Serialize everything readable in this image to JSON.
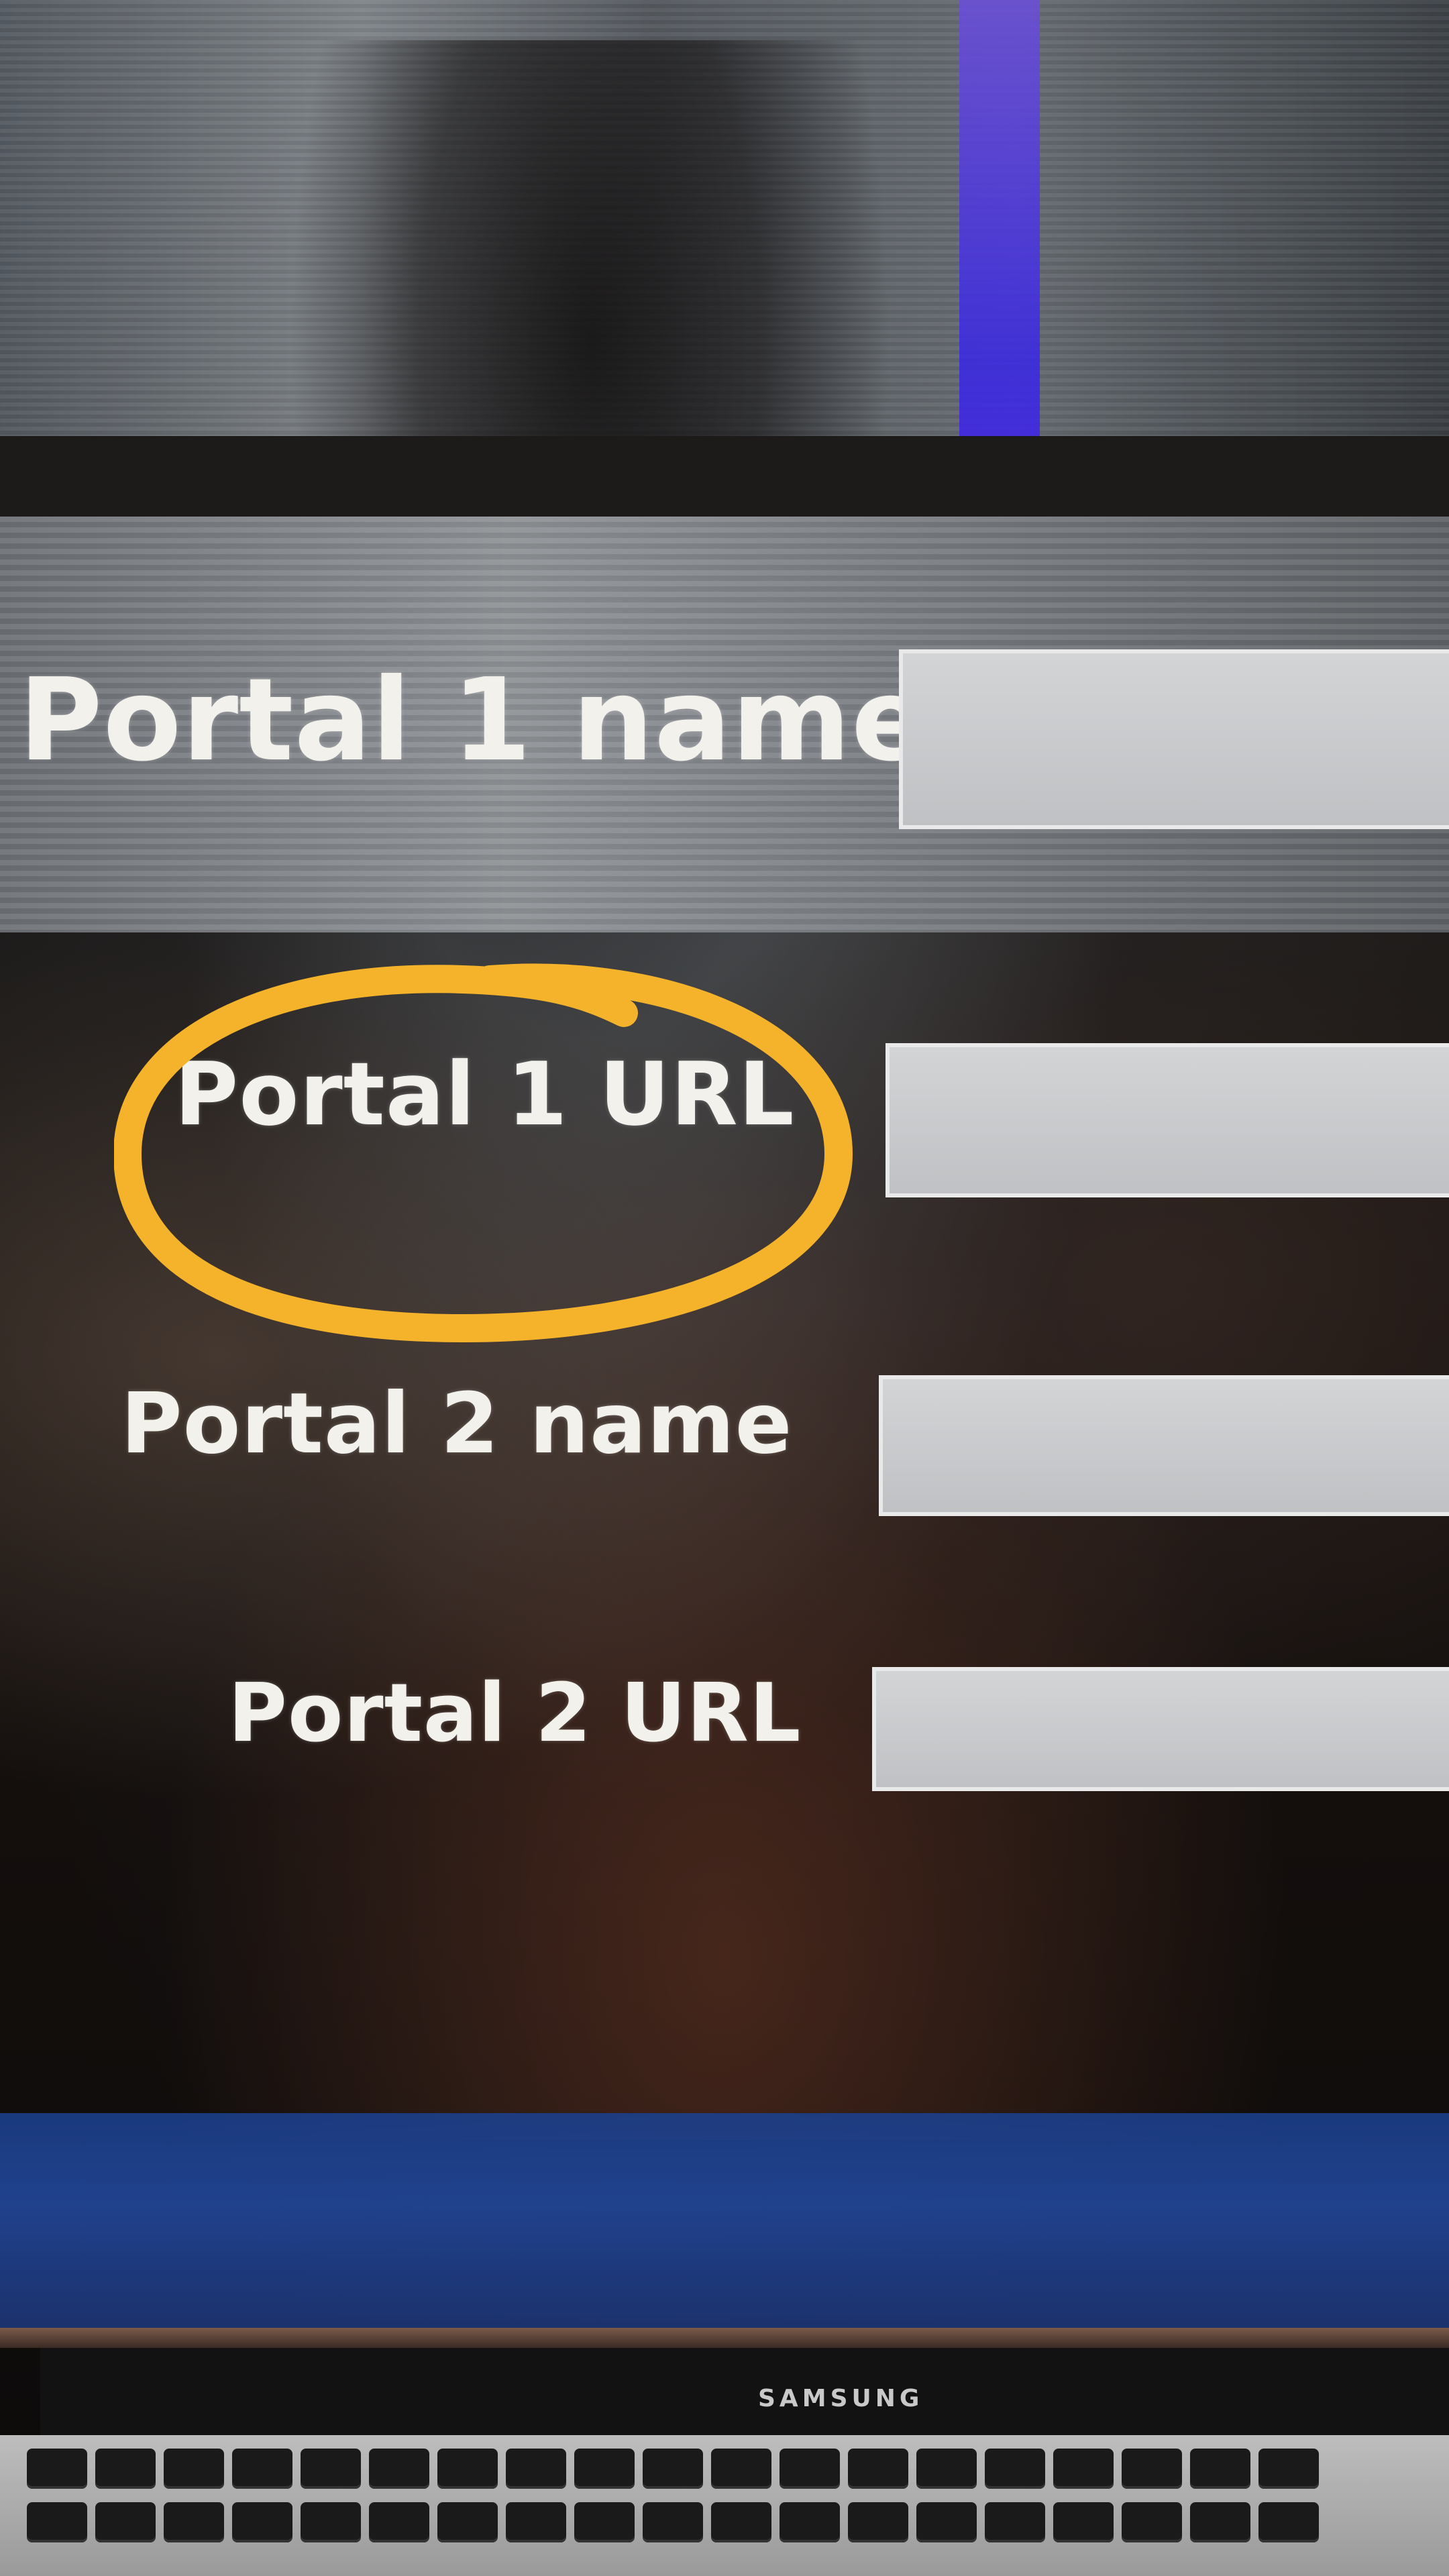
{
  "form": {
    "fields": [
      {
        "label": "Portal 1 name",
        "value": ""
      },
      {
        "label": "Portal 1 URL",
        "value": ""
      },
      {
        "label": "Portal 2 name",
        "value": ""
      },
      {
        "label": "Portal 2 URL",
        "value": ""
      }
    ]
  },
  "annotation": {
    "highlight_color": "#f4b32a"
  },
  "monitor": {
    "brand": "SAMSUNG"
  },
  "colors": {
    "label_text": "#f3f1ec",
    "input_fill": "#c9cacc",
    "input_border": "#e9e9ea"
  }
}
